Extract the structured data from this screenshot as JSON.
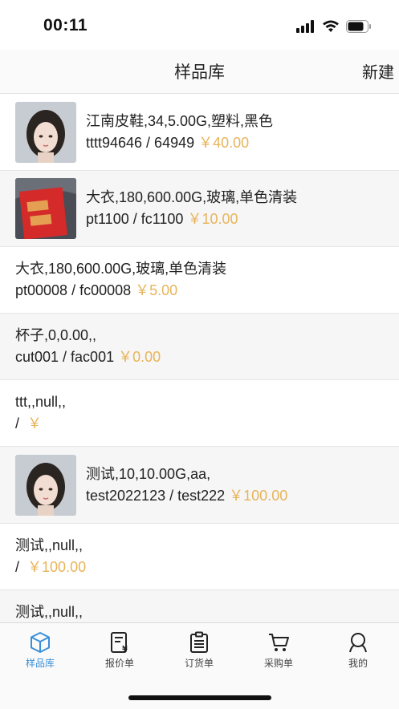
{
  "status": {
    "time": "00:11"
  },
  "nav": {
    "title": "样品库",
    "new_label": "新建"
  },
  "items": [
    {
      "title": "江南皮鞋,34,5.00G,塑料,黑色",
      "codes": "tttt94646 / 64949",
      "price": "￥40.00",
      "thumb": "doll"
    },
    {
      "title": "大衣,180,600.00G,玻璃,单色清装",
      "codes": "pt1100 / fc1100",
      "price": "￥10.00",
      "thumb": "redbook"
    },
    {
      "title": "大衣,180,600.00G,玻璃,单色清装",
      "codes": "pt00008 / fc00008",
      "price": "￥5.00"
    },
    {
      "title": "杯子,0,0.00,,",
      "codes": "cut001 / fac001",
      "price": "￥0.00"
    },
    {
      "title": "ttt,,null,,",
      "codes": "/ ",
      "price": "￥"
    },
    {
      "title": "测试,10,10.00G,aa,",
      "codes": "test2022123 / test222",
      "price": "￥100.00",
      "thumb": "doll"
    },
    {
      "title": "测试,,null,,",
      "codes": "/ ",
      "price": "￥100.00"
    },
    {
      "title": "测试,,null,,",
      "codes": "",
      "price": ""
    }
  ],
  "tabs": [
    {
      "label": "样品库",
      "icon": "cube-icon",
      "active": true
    },
    {
      "label": "报价单",
      "icon": "quote-icon",
      "active": false
    },
    {
      "label": "订货单",
      "icon": "clipboard-icon",
      "active": false
    },
    {
      "label": "采购单",
      "icon": "cart-icon",
      "active": false
    },
    {
      "label": "我的",
      "icon": "profile-icon",
      "active": false
    }
  ],
  "colors": {
    "accent": "#3a8fd9",
    "price": "#e8b45a"
  }
}
